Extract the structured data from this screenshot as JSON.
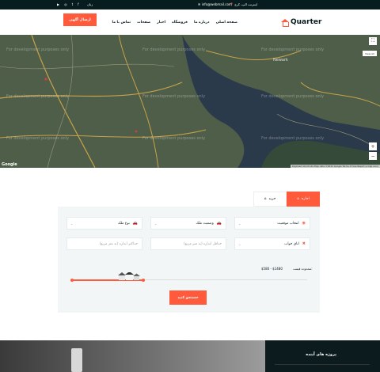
{
  "topbar": {
    "email": "info@webmail.com",
    "address": "اینترنت الپ، کرج",
    "language": "زبان"
  },
  "header": {
    "logo": "Quarter",
    "cta_label": "ارسال آگهی",
    "nav": [
      "صفحه اصلی",
      "درباره ما",
      "فروشگاه",
      "اخبار",
      "صفحات",
      "تماس با ما"
    ]
  },
  "map": {
    "dev_text": "For development purposes only",
    "view_all": "View All",
    "footer": "Keyboard shortcuts  Map data ©2022 Google  Terms of Use  Report a map error",
    "google": "Google",
    "place_label": "Newark"
  },
  "tabs": {
    "buy": "خرید",
    "rent": "اجاره"
  },
  "form": {
    "property_type": "نوع ملک",
    "property_status": "وضعیت ملک",
    "location": "انتخاب موقعیت",
    "min_size": "حداقل اندازه (به متر مربع)",
    "max_size": "حداکثر اندازه (به متر مربع)",
    "rooms": "اتاق خواب",
    "price_label": "محدوده قیمت:",
    "price_range": "$580 - $1480",
    "submit": "جستجو کنید"
  },
  "bottom": {
    "heading": "پروژه های آینده"
  },
  "colors": {
    "accent": "#ff5a3c",
    "dark": "#071c1f"
  }
}
